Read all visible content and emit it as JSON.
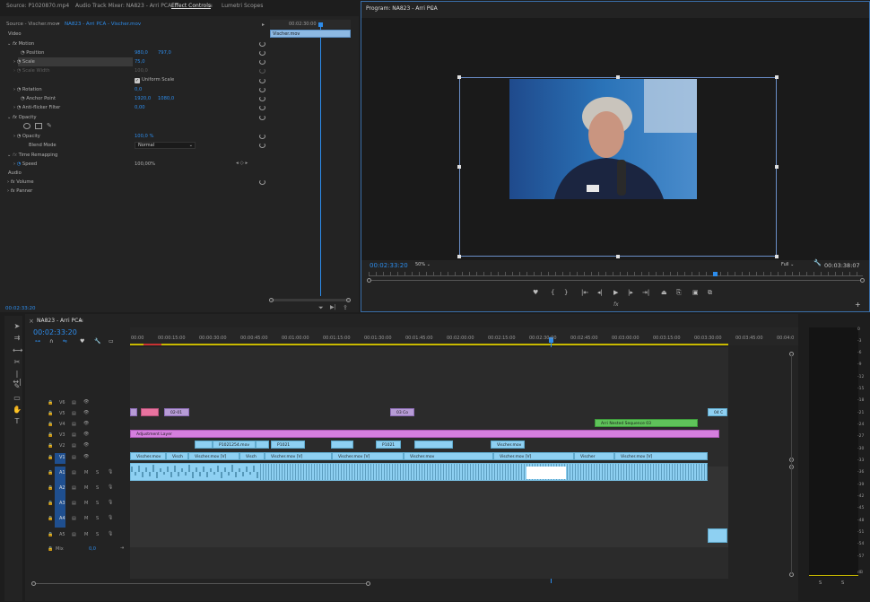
{
  "top_tabs": {
    "source": "Source: P1020870.mp4",
    "audio_mixer": "Audio Track Mixer: NA823 - Arri PCA",
    "effect_controls": "Effect Controls",
    "lumetri": "Lumetri Scopes",
    "program": "Program: NA823 - Arri PCA"
  },
  "ec": {
    "source_clip": "Source - Vischer.mov",
    "sequence_clip": "NA823 - Arri PCA - Vischer.mov",
    "mini_timecode": "00:02:30:00",
    "mini_clip": "Vischer.mov",
    "video_label": "Video",
    "motion": "Motion",
    "position": "Position",
    "position_x": "980,0",
    "position_y": "797,0",
    "scale": "Scale",
    "scale_val": "75,0",
    "scale_width": "Scale Width",
    "scale_width_val": "100,0",
    "uniform_scale": "Uniform Scale",
    "rotation": "Rotation",
    "rotation_val": "0,0",
    "anchor": "Anchor Point",
    "anchor_x": "1920,0",
    "anchor_y": "1080,0",
    "antiflicker": "Anti-flicker Filter",
    "antiflicker_val": "0,00",
    "opacity": "Opacity",
    "opacity_prop": "Opacity",
    "opacity_val": "100,0 %",
    "blend": "Blend Mode",
    "blend_val": "Normal",
    "time_remap": "Time Remapping",
    "speed": "Speed",
    "speed_val": "100,00%",
    "audio_label": "Audio",
    "volume": "Volume",
    "panner": "Panner",
    "timecode": "00:02:33:20"
  },
  "program": {
    "timecode": "00:02:33:20",
    "zoom": "50%",
    "quality": "Full",
    "duration": "00:03:38:07"
  },
  "timeline": {
    "title": "NA823 - Arri PCA",
    "timecode": "00:02:33:20",
    "ruler": [
      "00:00",
      "00:00:15:00",
      "00:00:30:00",
      "00:00:45:00",
      "00:01:00:00",
      "00:01:15:00",
      "00:01:30:00",
      "00:01:45:00",
      "00:02:00:00",
      "00:02:15:00",
      "00:02:30:00",
      "00:02:45:00",
      "00:03:00:00",
      "00:03:15:00",
      "00:03:30:00",
      "00:03:45:00",
      "00:04:0"
    ],
    "video_tracks": [
      "V6",
      "V5",
      "V4",
      "V3",
      "V2",
      "V1"
    ],
    "audio_tracks": [
      "A1",
      "A2",
      "A3",
      "A4",
      "A5"
    ],
    "mix": "Mix",
    "mix_val": "0,0",
    "m": "M",
    "s": "S",
    "clips": {
      "v5a": "02-01",
      "v5b": "03 Co",
      "v5c": "04 C",
      "v4": "Arri Nested Sequence 03",
      "v3": "Adjustment Layer",
      "v2a": "P1021254.mov",
      "v2b": "P1021",
      "v2c": "P1021",
      "v2d": "Vischer.mov",
      "v1": [
        "Vischer.mov",
        "Visch",
        "Vischer.mov [V]",
        "Visch",
        "Vischer.mov [V]",
        "Vischer.mov [V]",
        "Vischer.mov",
        "Vischer.mov [V]",
        "Vischer",
        "Vischer.mov [V]"
      ]
    }
  },
  "meter": {
    "labels": [
      "0",
      "-3",
      "-6",
      "-9",
      "-12",
      "-15",
      "-18",
      "-21",
      "-24",
      "-27",
      "-30",
      "-33",
      "-36",
      "-39",
      "-42",
      "-45",
      "-48",
      "-51",
      "-54",
      "-57",
      "dB"
    ],
    "bottom": [
      "S",
      "S"
    ]
  }
}
